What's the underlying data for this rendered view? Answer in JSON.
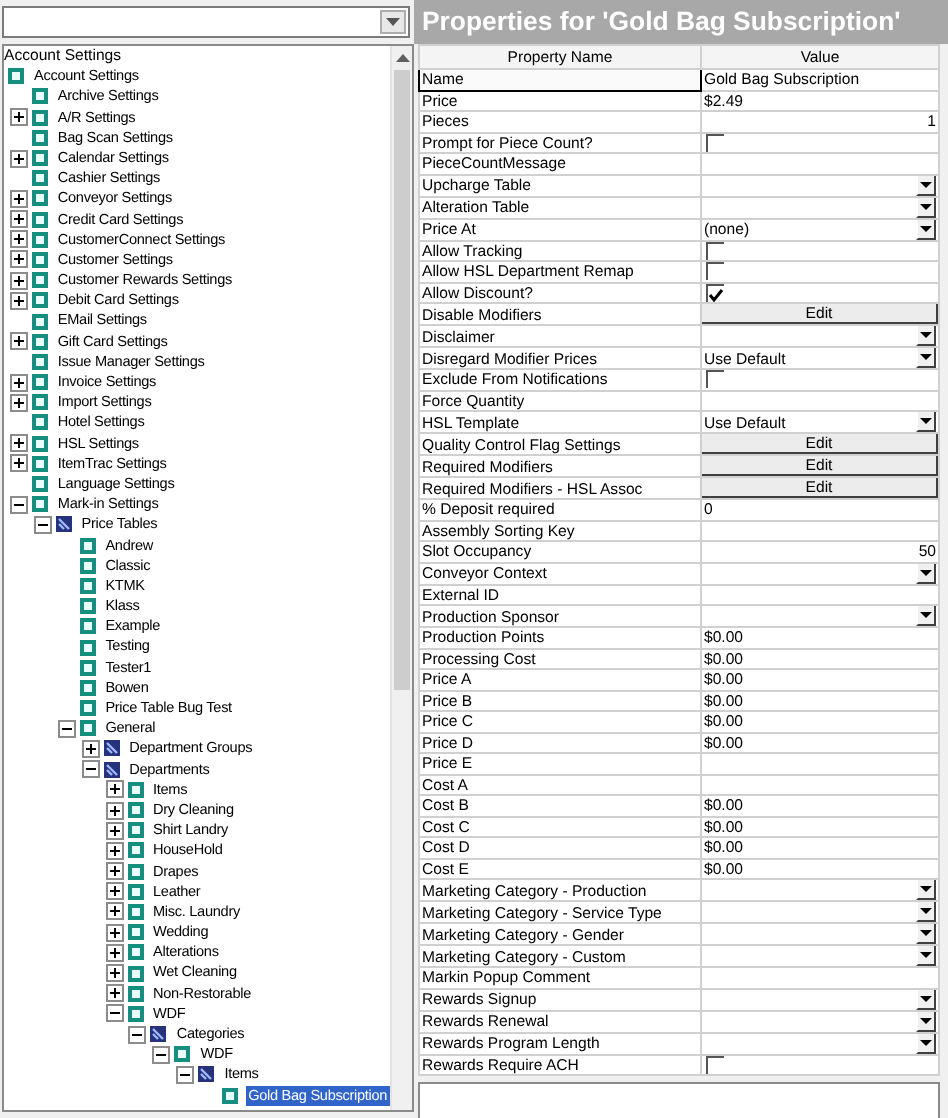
{
  "tree": {
    "header": "Account Settings",
    "items": [
      {
        "label": "Account Settings",
        "kind": "setting",
        "selected": false,
        "children": [
          {
            "label": "Archive Settings",
            "kind": "setting",
            "selected": false
          },
          {
            "label": "A/R Settings",
            "kind": "setting",
            "expanded": false,
            "selected": false
          },
          {
            "label": "Bag Scan Settings",
            "kind": "setting",
            "selected": false
          },
          {
            "label": "Calendar Settings",
            "kind": "setting",
            "expanded": false,
            "selected": false
          },
          {
            "label": "Cashier Settings",
            "kind": "setting",
            "selected": false
          },
          {
            "label": "Conveyor Settings",
            "kind": "setting",
            "expanded": false,
            "selected": false
          },
          {
            "label": "Credit Card Settings",
            "kind": "setting",
            "expanded": false,
            "selected": false
          },
          {
            "label": "CustomerConnect Settings",
            "kind": "setting",
            "expanded": false,
            "selected": false
          },
          {
            "label": "Customer Settings",
            "kind": "setting",
            "expanded": false,
            "selected": false
          },
          {
            "label": "Customer Rewards Settings",
            "kind": "setting",
            "expanded": false,
            "selected": false
          },
          {
            "label": "Debit Card Settings",
            "kind": "setting",
            "expanded": false,
            "selected": false
          },
          {
            "label": "EMail Settings",
            "kind": "setting",
            "selected": false
          },
          {
            "label": "Gift Card Settings",
            "kind": "setting",
            "expanded": false,
            "selected": false
          },
          {
            "label": "Issue Manager Settings",
            "kind": "setting",
            "selected": false
          },
          {
            "label": "Invoice Settings",
            "kind": "setting",
            "expanded": false,
            "selected": false
          },
          {
            "label": "Import Settings",
            "kind": "setting",
            "expanded": false,
            "selected": false
          },
          {
            "label": "Hotel Settings",
            "kind": "setting",
            "selected": false
          },
          {
            "label": "HSL Settings",
            "kind": "setting",
            "expanded": false,
            "selected": false
          },
          {
            "label": "ItemTrac Settings",
            "kind": "setting",
            "expanded": false,
            "selected": false
          },
          {
            "label": "Language Settings",
            "kind": "setting",
            "selected": false
          },
          {
            "label": "Mark-in Settings",
            "kind": "setting",
            "expanded": true,
            "selected": false,
            "children": [
              {
                "label": "Price Tables",
                "kind": "group",
                "expanded": true,
                "selected": false,
                "children": [
                  {
                    "label": "Andrew",
                    "kind": "setting",
                    "selected": false
                  },
                  {
                    "label": "Classic",
                    "kind": "setting",
                    "selected": false
                  },
                  {
                    "label": "KTMK",
                    "kind": "setting",
                    "selected": false
                  },
                  {
                    "label": "Klass",
                    "kind": "setting",
                    "selected": false
                  },
                  {
                    "label": "Example",
                    "kind": "setting",
                    "selected": false
                  },
                  {
                    "label": "Testing",
                    "kind": "setting",
                    "selected": false
                  },
                  {
                    "label": "Tester1",
                    "kind": "setting",
                    "selected": false
                  },
                  {
                    "label": "Bowen",
                    "kind": "setting",
                    "selected": false
                  },
                  {
                    "label": "Price Table Bug Test",
                    "kind": "setting",
                    "selected": false
                  },
                  {
                    "label": "General",
                    "kind": "setting",
                    "expanded": true,
                    "selected": false,
                    "children": [
                      {
                        "label": "Department Groups",
                        "kind": "group",
                        "expanded": false,
                        "selected": false
                      },
                      {
                        "label": "Departments",
                        "kind": "group",
                        "expanded": true,
                        "selected": false,
                        "children": [
                          {
                            "label": "Items",
                            "kind": "setting",
                            "expanded": false,
                            "selected": false
                          },
                          {
                            "label": "Dry Cleaning",
                            "kind": "setting",
                            "expanded": false,
                            "selected": false
                          },
                          {
                            "label": "Shirt Landry",
                            "kind": "setting",
                            "expanded": false,
                            "selected": false
                          },
                          {
                            "label": "HouseHold",
                            "kind": "setting",
                            "expanded": false,
                            "selected": false
                          },
                          {
                            "label": "Drapes",
                            "kind": "setting",
                            "expanded": false,
                            "selected": false
                          },
                          {
                            "label": "Leather",
                            "kind": "setting",
                            "expanded": false,
                            "selected": false
                          },
                          {
                            "label": "Misc. Laundry",
                            "kind": "setting",
                            "expanded": false,
                            "selected": false
                          },
                          {
                            "label": "Wedding",
                            "kind": "setting",
                            "expanded": false,
                            "selected": false
                          },
                          {
                            "label": "Alterations",
                            "kind": "setting",
                            "expanded": false,
                            "selected": false
                          },
                          {
                            "label": "Wet Cleaning",
                            "kind": "setting",
                            "expanded": false,
                            "selected": false
                          },
                          {
                            "label": "Non-Restorable",
                            "kind": "setting",
                            "expanded": false,
                            "selected": false
                          },
                          {
                            "label": "WDF",
                            "kind": "setting",
                            "expanded": true,
                            "selected": false,
                            "children": [
                              {
                                "label": "Categories",
                                "kind": "group",
                                "expanded": true,
                                "selected": false,
                                "children": [
                                  {
                                    "label": "WDF",
                                    "kind": "setting",
                                    "expanded": true,
                                    "selected": false,
                                    "children": [
                                      {
                                        "label": "Items",
                                        "kind": "group",
                                        "expanded": true,
                                        "selected": false,
                                        "children": [
                                          {
                                            "label": "Gold Bag Subscription",
                                            "kind": "setting",
                                            "selected": true
                                          }
                                        ]
                                      }
                                    ]
                                  }
                                ]
                              }
                            ]
                          }
                        ]
                      }
                    ]
                  }
                ]
              }
            ]
          }
        ]
      }
    ]
  },
  "properties": {
    "title": "Properties for 'Gold Bag Subscription'",
    "columns": [
      "Property Name",
      "Value"
    ],
    "rows": [
      {
        "name": "Name",
        "kind": "text",
        "value": "Gold Bag Subscription",
        "focused": true
      },
      {
        "name": "Price",
        "kind": "text",
        "value": "$2.49",
        "focused": false
      },
      {
        "name": "Pieces",
        "kind": "number",
        "value": "1",
        "focused": false
      },
      {
        "name": "Prompt for Piece Count?",
        "kind": "check",
        "checked": false,
        "focused": false
      },
      {
        "name": "PieceCountMessage",
        "kind": "text",
        "focused": false
      },
      {
        "name": "Upcharge Table",
        "kind": "select",
        "focused": false
      },
      {
        "name": "Alteration Table",
        "kind": "select",
        "focused": false
      },
      {
        "name": "Price At",
        "kind": "select",
        "value": "(none)",
        "focused": false
      },
      {
        "name": "Allow Tracking",
        "kind": "check",
        "checked": false,
        "focused": false
      },
      {
        "name": "Allow HSL Department Remap",
        "kind": "check",
        "checked": false,
        "focused": false
      },
      {
        "name": "Allow Discount?",
        "kind": "check",
        "checked": true,
        "focused": false
      },
      {
        "name": "Disable Modifiers",
        "kind": "button",
        "value": "Edit",
        "focused": false
      },
      {
        "name": "Disclaimer",
        "kind": "select",
        "focused": false
      },
      {
        "name": "Disregard Modifier Prices",
        "kind": "select",
        "value": "Use Default",
        "focused": false
      },
      {
        "name": "Exclude From Notifications",
        "kind": "check",
        "checked": false,
        "focused": false
      },
      {
        "name": "Force Quantity",
        "kind": "text",
        "focused": false
      },
      {
        "name": "HSL Template",
        "kind": "select",
        "value": "Use Default",
        "focused": false
      },
      {
        "name": "Quality Control Flag Settings",
        "kind": "button",
        "value": "Edit",
        "focused": false
      },
      {
        "name": "Required Modifiers",
        "kind": "button",
        "value": "Edit",
        "focused": false
      },
      {
        "name": "Required Modifiers - HSL Assoc",
        "kind": "button",
        "value": "Edit",
        "focused": false
      },
      {
        "name": "% Deposit required",
        "kind": "text",
        "value": "0",
        "focused": false
      },
      {
        "name": "Assembly Sorting Key",
        "kind": "text",
        "focused": false
      },
      {
        "name": "Slot Occupancy",
        "kind": "number",
        "value": "50",
        "focused": false
      },
      {
        "name": "Conveyor Context",
        "kind": "select",
        "focused": false
      },
      {
        "name": "External ID",
        "kind": "text",
        "focused": false
      },
      {
        "name": "Production Sponsor",
        "kind": "select",
        "focused": false
      },
      {
        "name": "Production Points",
        "kind": "text",
        "value": "$0.00",
        "focused": false
      },
      {
        "name": "Processing Cost",
        "kind": "text",
        "value": "$0.00",
        "focused": false
      },
      {
        "name": "Price A",
        "kind": "text",
        "value": "$0.00",
        "focused": false
      },
      {
        "name": "Price B",
        "kind": "text",
        "value": "$0.00",
        "focused": false
      },
      {
        "name": "Price C",
        "kind": "text",
        "value": "$0.00",
        "focused": false
      },
      {
        "name": "Price D",
        "kind": "text",
        "value": "$0.00",
        "focused": false
      },
      {
        "name": "Price E",
        "kind": "text",
        "focused": false
      },
      {
        "name": "Cost A",
        "kind": "text",
        "focused": false
      },
      {
        "name": "Cost B",
        "kind": "text",
        "value": "$0.00",
        "focused": false
      },
      {
        "name": "Cost C",
        "kind": "text",
        "value": "$0.00",
        "focused": false
      },
      {
        "name": "Cost D",
        "kind": "text",
        "value": "$0.00",
        "focused": false
      },
      {
        "name": "Cost E",
        "kind": "text",
        "value": "$0.00",
        "focused": false
      },
      {
        "name": "Marketing Category - Production",
        "kind": "select",
        "focused": false
      },
      {
        "name": "Marketing Category - Service Type",
        "kind": "select",
        "focused": false
      },
      {
        "name": "Marketing Category - Gender",
        "kind": "select",
        "focused": false
      },
      {
        "name": "Marketing Category - Custom",
        "kind": "select",
        "focused": false
      },
      {
        "name": "Markin Popup Comment",
        "kind": "text",
        "focused": false
      },
      {
        "name": "Rewards Signup",
        "kind": "select",
        "focused": false
      },
      {
        "name": "Rewards Renewal",
        "kind": "select",
        "focused": false
      },
      {
        "name": "Rewards Program Length",
        "kind": "select",
        "focused": false
      },
      {
        "name": "Rewards Require ACH",
        "kind": "check",
        "checked": false,
        "focused": false
      }
    ]
  }
}
